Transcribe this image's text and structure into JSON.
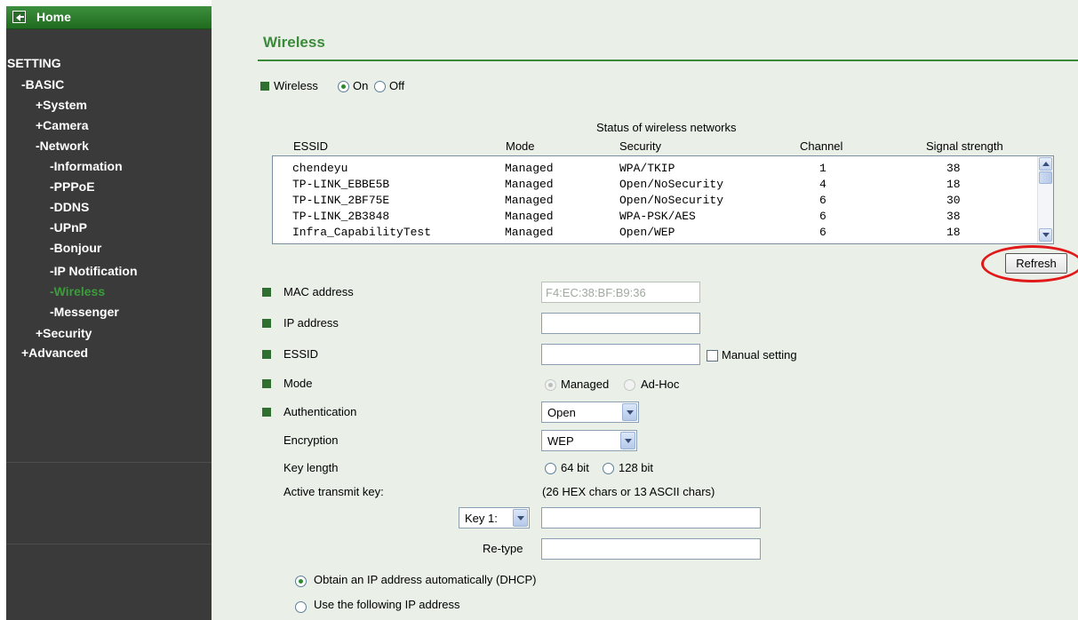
{
  "sidebar": {
    "home": "Home",
    "setting": "SETTING",
    "basic": "-BASIC",
    "system": "+System",
    "camera": "+Camera",
    "network": "-Network",
    "information": "-Information",
    "pppoe": "-PPPoE",
    "ddns": "-DDNS",
    "upnp": "-UPnP",
    "bonjour": "-Bonjour",
    "ip_notification": "-IP Notification",
    "wireless": "-Wireless",
    "messenger": "-Messenger",
    "security": "+Security",
    "advanced": "+Advanced"
  },
  "page": {
    "title": "Wireless"
  },
  "wireless_toggle": {
    "label": "Wireless",
    "on": "On",
    "off": "Off",
    "selected": "On"
  },
  "networks": {
    "caption": "Status of wireless networks",
    "headers": [
      "ESSID",
      "Mode",
      "Security",
      "Channel",
      "Signal strength"
    ],
    "rows": [
      [
        "chendeyu",
        "Managed",
        "WPA/TKIP",
        "1",
        "38"
      ],
      [
        "TP-LINK_EBBE5B",
        "Managed",
        "Open/NoSecurity",
        "4",
        "18"
      ],
      [
        "TP-LINK_2BF75E",
        "Managed",
        "Open/NoSecurity",
        "6",
        "30"
      ],
      [
        "TP-LINK_2B3848",
        "Managed",
        "WPA-PSK/AES",
        "6",
        "38"
      ],
      [
        "Infra_CapabilityTest",
        "Managed",
        "Open/WEP",
        "6",
        "18"
      ]
    ],
    "refresh": "Refresh"
  },
  "form": {
    "mac_label": "MAC address",
    "mac_value": "F4:EC:38:BF:B9:36",
    "ip_label": "IP address",
    "ip_value": "",
    "essid_label": "ESSID",
    "essid_value": "",
    "manual_setting": "Manual setting",
    "mode_label": "Mode",
    "mode_managed": "Managed",
    "mode_adhoc": "Ad-Hoc",
    "auth_label": "Authentication",
    "auth_value": "Open",
    "encryption_label": "Encryption",
    "encryption_value": "WEP",
    "keylength_label": "Key length",
    "key64": "64 bit",
    "key128": "128 bit",
    "active_key_label": "Active transmit key:",
    "key_hint": "(26 HEX chars or 13 ASCII chars)",
    "key_select": "Key 1:",
    "retype_label": "Re-type",
    "dhcp_label": "Obtain an IP address automatically (DHCP)",
    "static_label": "Use the following IP address"
  },
  "colors": {
    "accent": "#3a8a3a",
    "highlight": "#e01a1a",
    "sidebar_bg": "#3a3a3a"
  }
}
